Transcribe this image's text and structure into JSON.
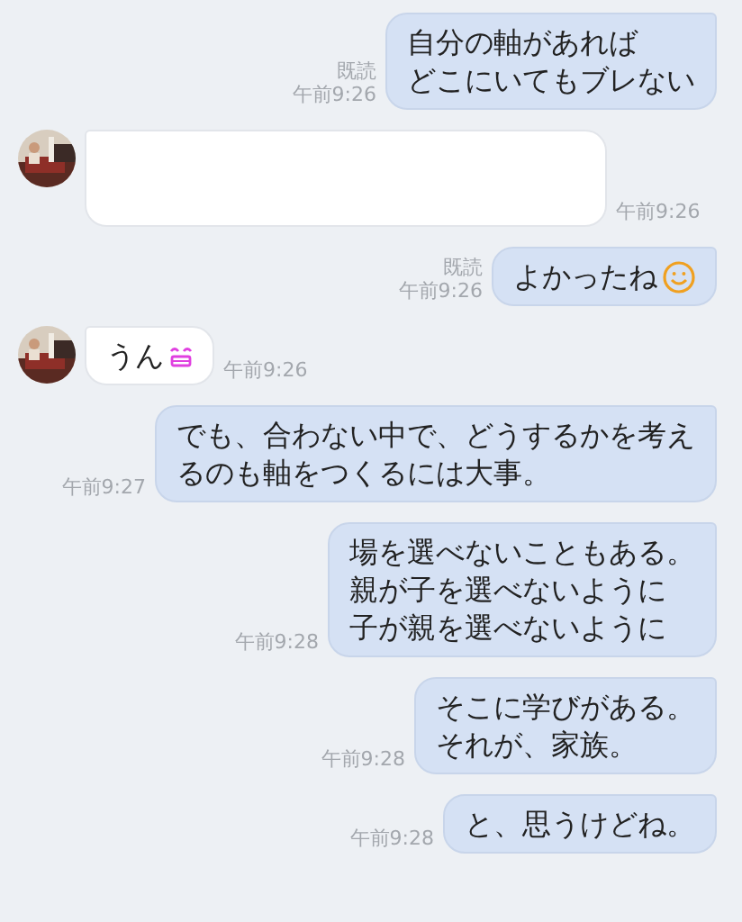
{
  "messages": [
    {
      "kind": "sent",
      "lines": [
        "自分の軸があれば",
        "どこにいてもブレない"
      ],
      "receipt": "既読",
      "time": "午前9:26"
    },
    {
      "kind": "received",
      "time": "午前9:26"
    },
    {
      "kind": "sent",
      "lines": [
        "よかったね"
      ],
      "emoji": {
        "kind": "smile"
      },
      "receipt": "既読",
      "time": "午前9:26"
    },
    {
      "kind": "received",
      "lines": [
        "うん"
      ],
      "emoji": {
        "kind": "grin"
      },
      "time": "午前9:26"
    },
    {
      "kind": "sent",
      "lines": [
        "でも、合わない中で、どうするかを考え",
        "るのも軸をつくるには大事。"
      ],
      "time": "午前9:27"
    },
    {
      "kind": "sent",
      "lines": [
        "場を選べないこともある。",
        "親が子を選べないように",
        "子が親を選べないように"
      ],
      "time": "午前9:28"
    },
    {
      "kind": "sent",
      "lines": [
        "そこに学びがある。",
        "それが、家族。"
      ],
      "time": "午前9:28"
    },
    {
      "kind": "sent",
      "lines": [
        "と、思うけどね。"
      ],
      "time": "午前9:28"
    }
  ]
}
